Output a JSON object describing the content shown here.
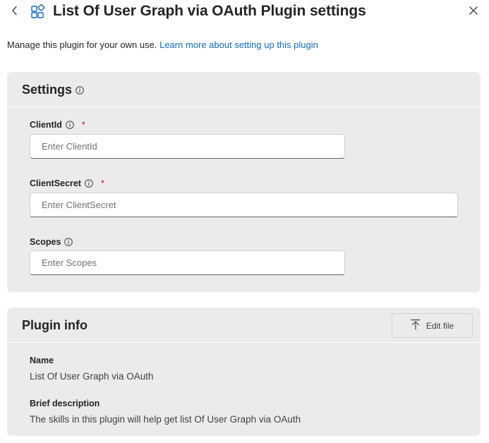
{
  "header": {
    "title": "List Of User Graph via OAuth Plugin settings",
    "back_icon": "chevron-left-icon",
    "plugin_icon": "apps-add-in-icon",
    "close_icon": "close-icon"
  },
  "description": {
    "text": "Manage this plugin for your own use.",
    "link_text": "Learn more about setting up this plugin"
  },
  "settings": {
    "title": "Settings",
    "fields": [
      {
        "label": "ClientId",
        "required_mark": "*",
        "placeholder": "Enter ClientId",
        "value": ""
      },
      {
        "label": "ClientSecret",
        "required_mark": "*",
        "placeholder": "Enter ClientSecret",
        "value": ""
      },
      {
        "label": "Scopes",
        "placeholder": "Enter Scopes",
        "value": ""
      }
    ]
  },
  "plugin_info": {
    "title": "Plugin info",
    "edit_button": "Edit file",
    "edit_icon": "arrow-upload-icon",
    "name_label": "Name",
    "name_value": "List Of User Graph via OAuth",
    "brief_label": "Brief description",
    "brief_value": "The skills in this plugin will help get list Of User Graph via OAuth"
  },
  "colors": {
    "accent_link": "#0f6cbd",
    "card_background": "#ebebeb",
    "required": "#c50f1f",
    "plugin_icon": "#0f6cbd"
  }
}
